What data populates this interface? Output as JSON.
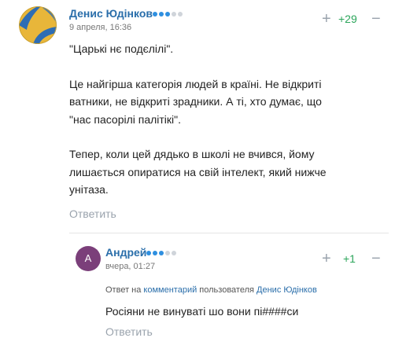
{
  "comment1": {
    "author": "Денис Юдінков",
    "rank_dots": 5,
    "rank_active": 3,
    "date": "9 апреля, 16:36",
    "score": "+29",
    "paragraphs": [
      "\"Царькі нє подєлілі\".",
      "Це найгірша категорія людей в країні. Не відкриті ватники, не відкриті зрадники. А ті, хто думає, що \"нас пасорілі палітікі\".",
      "Тепер, коли цей дядько в школі не вчився, йому лишається опиратися на свій інтелект, який нижче унітаза."
    ],
    "reply_label": "Ответить"
  },
  "comment2": {
    "avatar_letter": "А",
    "author": "Андрей",
    "rank_dots": 5,
    "rank_active": 3,
    "date": "вчера, 01:27",
    "score": "+1",
    "reply_prefix": "Ответ на",
    "reply_link": "комментарий",
    "reply_middle": "пользователя",
    "reply_user": "Денис Юдінков",
    "text": "Росіяни не винуваті шо вони пі####си",
    "reply_label": "Ответить"
  },
  "colors": {
    "author": "#2a6eaa",
    "score": "#2ba55a",
    "rank_dot": "#2e8fe0",
    "avatar_a": "#7b3f7a"
  },
  "icons": {
    "avatar1": "football-ball-avatar",
    "vote_up": "plus-icon",
    "vote_down": "minus-icon"
  }
}
